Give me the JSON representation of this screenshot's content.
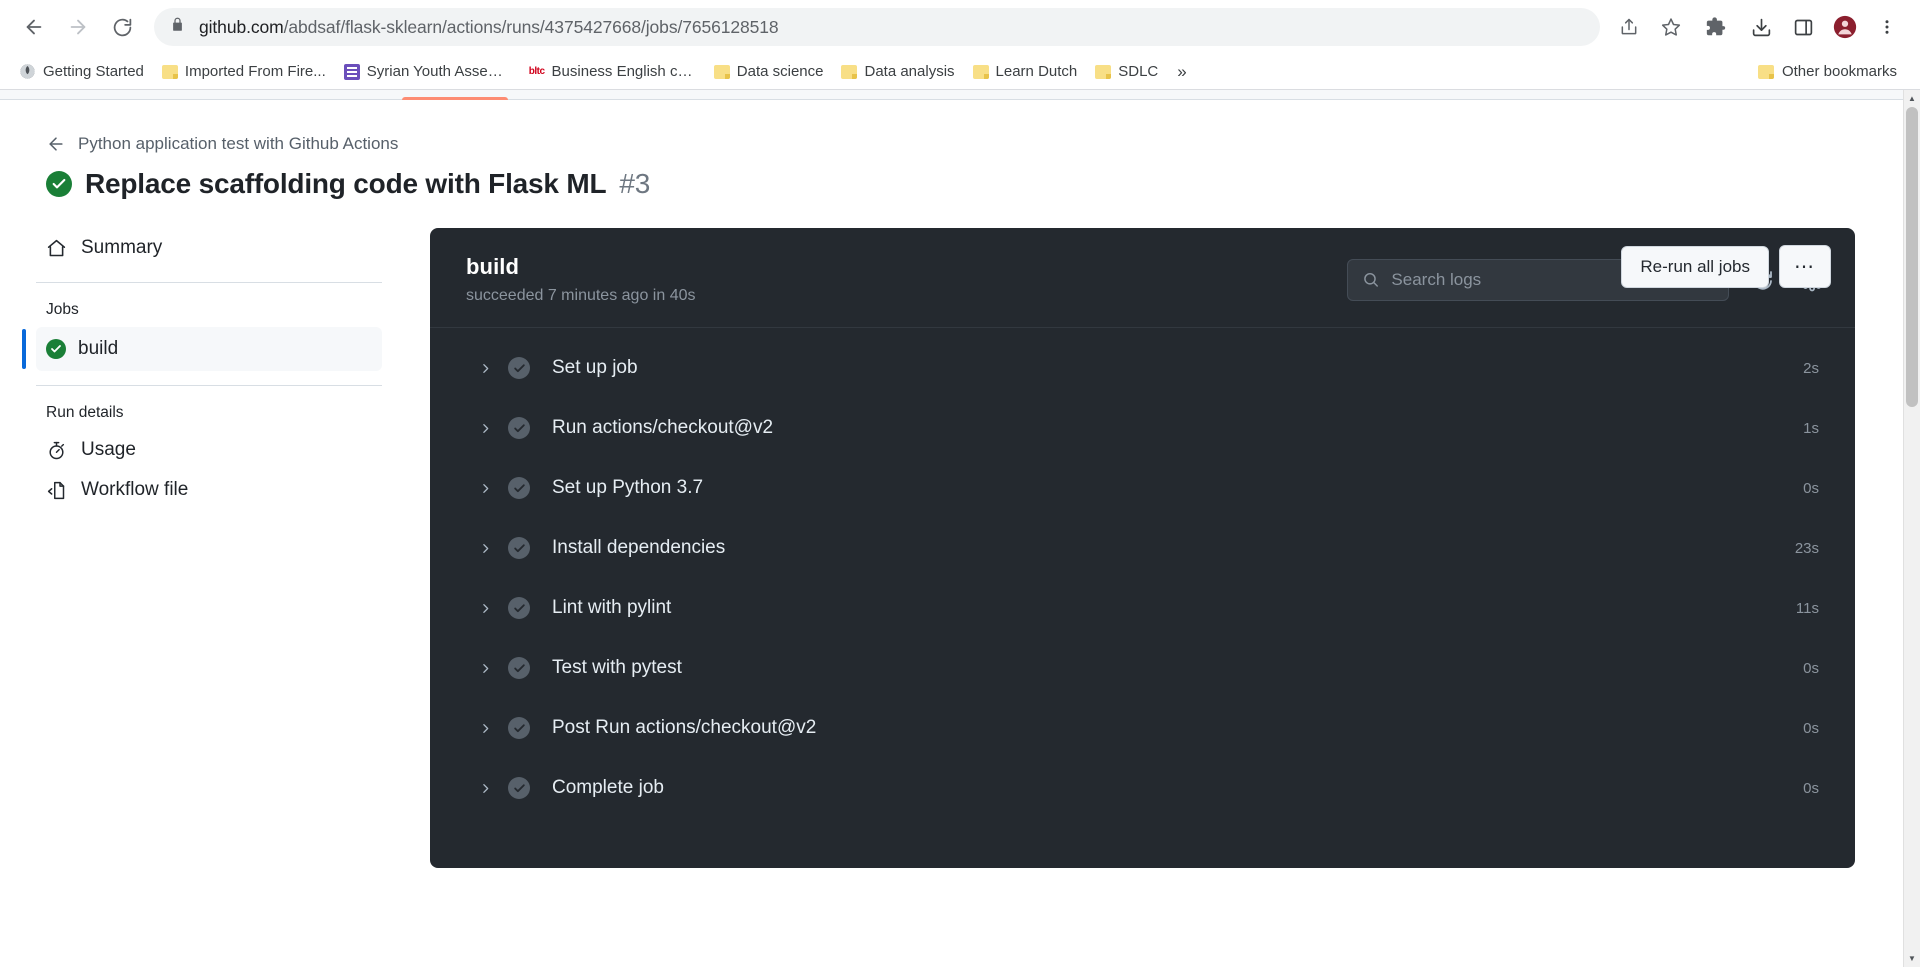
{
  "browser": {
    "url_host": "github.com",
    "url_path": "/abdsaf/flask-sklearn/actions/runs/4375427668/jobs/7656128518",
    "nav": {
      "back_label": "Back",
      "forward_label": "Forward",
      "reload_label": "Reload"
    },
    "toolbar_icons": [
      {
        "name": "share-icon",
        "label": "Share this page"
      },
      {
        "name": "star-icon",
        "label": "Bookmark this tab"
      },
      {
        "name": "extensions-icon",
        "label": "Extensions"
      },
      {
        "name": "downloads-icon",
        "label": "Downloads"
      },
      {
        "name": "sidepanel-icon",
        "label": "Side panel"
      },
      {
        "name": "profile-icon",
        "label": "Profile"
      },
      {
        "name": "menu-icon",
        "label": "Customize and control"
      }
    ],
    "bookmarks": [
      {
        "label": "Getting Started",
        "icon": "globe-icon"
      },
      {
        "label": "Imported From Fire...",
        "icon": "folder-icon"
      },
      {
        "label": "Syrian Youth Assem...",
        "icon": "grid-icon"
      },
      {
        "label": "Business English co...",
        "icon": "bltc-icon"
      },
      {
        "label": "Data science",
        "icon": "folder-icon"
      },
      {
        "label": "Data analysis",
        "icon": "folder-icon"
      },
      {
        "label": "Learn Dutch",
        "icon": "folder-icon"
      },
      {
        "label": "SDLC",
        "icon": "folder-icon"
      }
    ],
    "bookmarks_overflow": "»",
    "other_bookmarks": "Other bookmarks"
  },
  "page": {
    "breadcrumb": "Python application test with Github Actions",
    "run_title": "Replace scaffolding code with Flask ML",
    "run_number": "#3",
    "run_status": "success",
    "actions": {
      "rerun_label": "Re-run all jobs",
      "more_label": "⋯"
    },
    "sidebar": {
      "summary_label": "Summary",
      "jobs_heading": "Jobs",
      "jobs": [
        {
          "label": "build",
          "status": "success",
          "selected": true
        }
      ],
      "run_details_heading": "Run details",
      "run_details": [
        {
          "label": "Usage",
          "icon": "stopwatch-icon"
        },
        {
          "label": "Workflow file",
          "icon": "code-file-icon"
        }
      ]
    },
    "log_panel": {
      "job_name": "build",
      "job_subtitle": "succeeded 7 minutes ago in 40s",
      "search_placeholder": "Search logs",
      "search_value": "",
      "refresh_label": "Refresh",
      "settings_label": "Settings",
      "steps": [
        {
          "name": "Set up job",
          "duration": "2s",
          "status": "success"
        },
        {
          "name": "Run actions/checkout@v2",
          "duration": "1s",
          "status": "success"
        },
        {
          "name": "Set up Python 3.7",
          "duration": "0s",
          "status": "success"
        },
        {
          "name": "Install dependencies",
          "duration": "23s",
          "status": "success"
        },
        {
          "name": "Lint with pylint",
          "duration": "11s",
          "status": "success"
        },
        {
          "name": "Test with pytest",
          "duration": "0s",
          "status": "success"
        },
        {
          "name": "Post Run actions/checkout@v2",
          "duration": "0s",
          "status": "success"
        },
        {
          "name": "Complete job",
          "duration": "0s",
          "status": "success"
        }
      ]
    }
  },
  "colors": {
    "accent_tab": "#fd8c73",
    "success_green": "#1a7f37",
    "selected_blue": "#0969da",
    "panel_dark": "#24292f"
  }
}
